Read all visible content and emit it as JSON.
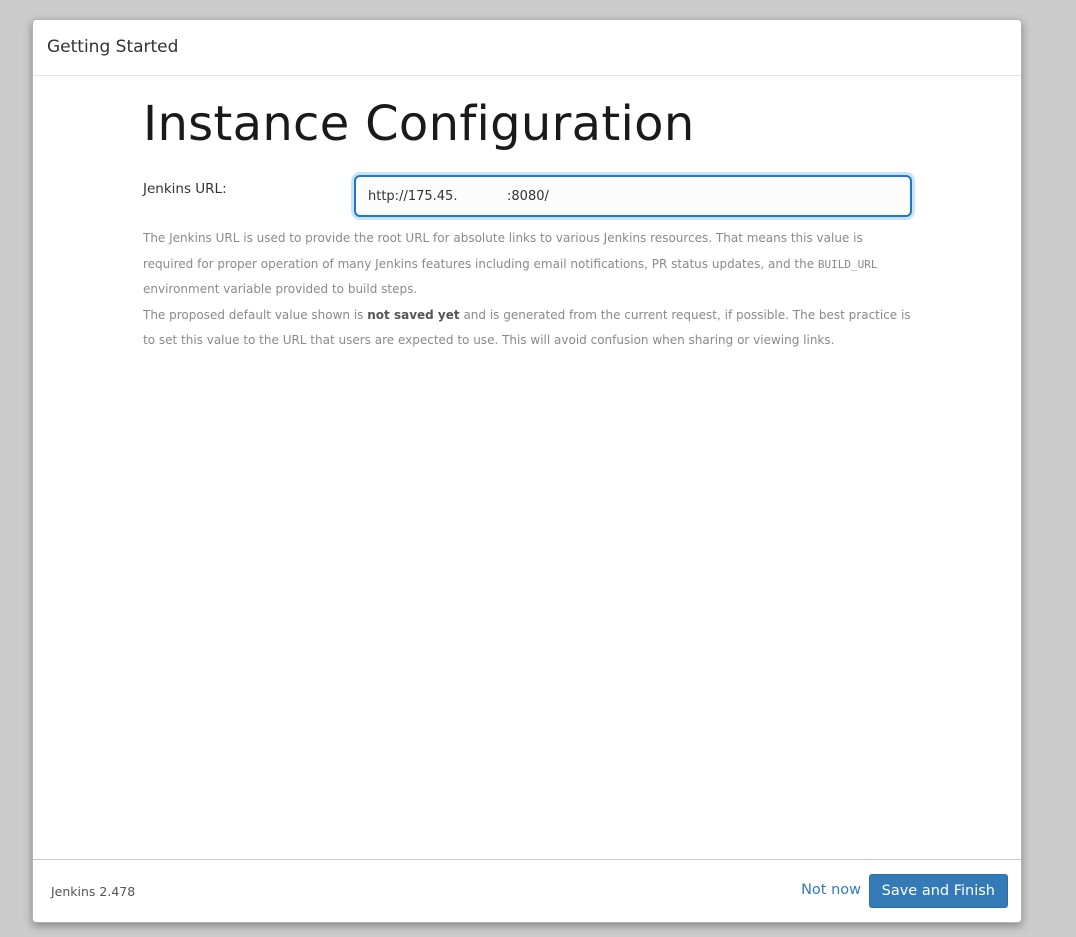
{
  "dialog": {
    "title": "Getting Started"
  },
  "main": {
    "heading": "Instance Configuration",
    "url_field": {
      "label": "Jenkins URL:",
      "value": "http://175.45.            :8080/"
    },
    "help": {
      "p1_part1": "The Jenkins URL is used to provide the root URL for absolute links to various Jenkins resources. That means this value is required for proper operation of many Jenkins features including email notifications, PR status updates, and the ",
      "p1_code": "BUILD_URL",
      "p1_part2": " environment variable provided to build steps.",
      "p2_part1": "The proposed default value shown is ",
      "p2_bold": "not saved yet",
      "p2_part2": " and is generated from the current request, if possible. The best practice is to set this value to the URL that users are expected to use. This will avoid confusion when sharing or viewing links."
    }
  },
  "footer": {
    "version": "Jenkins 2.478",
    "not_now_label": "Not now",
    "save_label": "Save and Finish"
  },
  "colors": {
    "primary": "#337ab7",
    "input_focus": "#1e78c8",
    "backdrop": "#cccccc"
  }
}
